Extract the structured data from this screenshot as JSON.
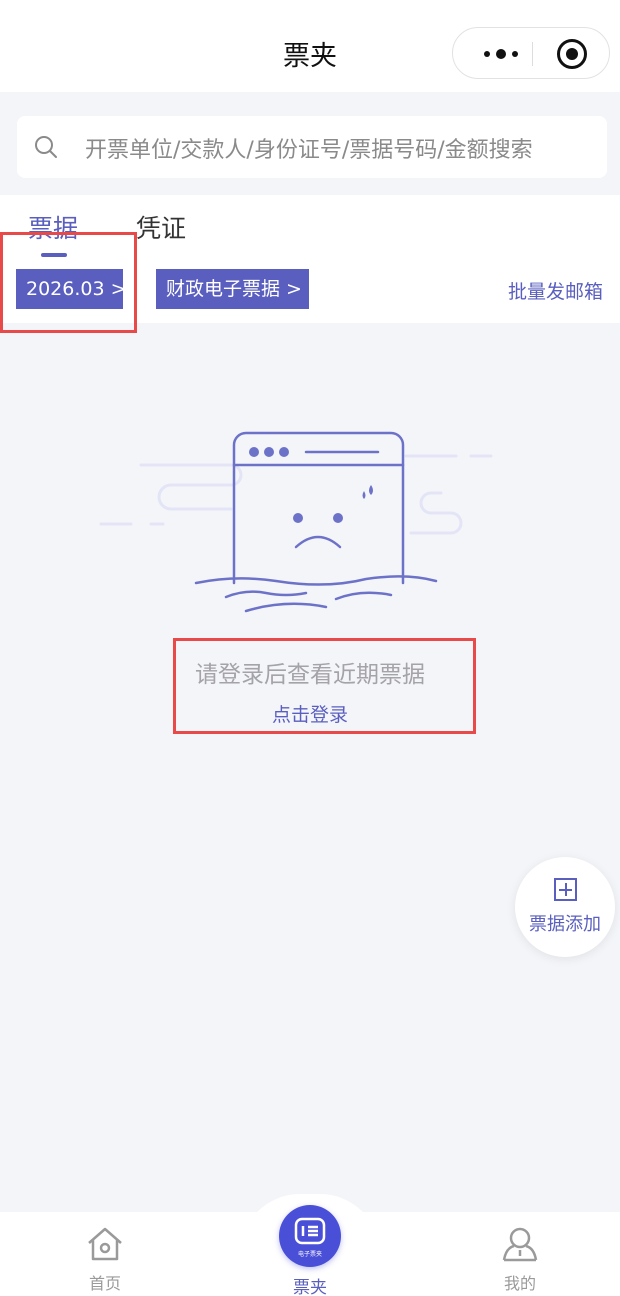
{
  "header": {
    "title": "票夹"
  },
  "search": {
    "placeholder": "开票单位/交款人/身份证号/票据号码/金额搜索"
  },
  "tabs": [
    {
      "label": "票据",
      "active": true
    },
    {
      "label": "凭证",
      "active": false
    }
  ],
  "filters": {
    "date": "2026.03 >",
    "type": "财政电子票据 >",
    "batch_email": "批量发邮箱"
  },
  "empty_state": {
    "message": "请登录后查看近期票据",
    "login_link": "点击登录"
  },
  "fab": {
    "label": "票据添加"
  },
  "bottom_nav": {
    "home": "首页",
    "wallet": "票夹",
    "wallet_icon_caption": "电子票夹",
    "mine": "我的"
  },
  "colors": {
    "accent": "#5a5fbf",
    "annotation": "#e84a4a",
    "background": "#f4f5f9"
  }
}
